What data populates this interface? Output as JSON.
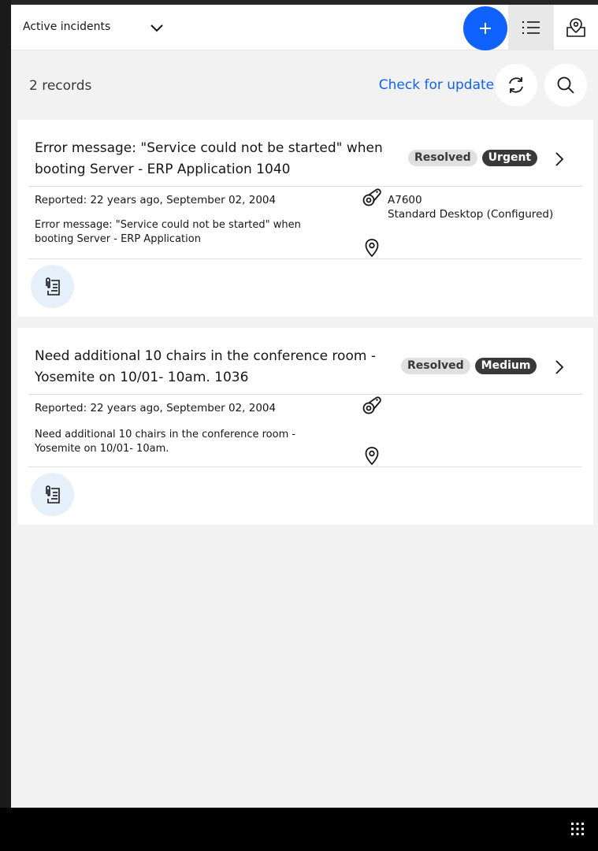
{
  "header": {
    "filter_label": "Active incidents",
    "icons": {
      "chevron": "chevron-down-icon",
      "add": "add-icon",
      "list": "list-view-icon",
      "map": "map-view-icon"
    }
  },
  "toolbar": {
    "records_count": "2 records",
    "check_updates_label": "Check for updates"
  },
  "colors": {
    "accent": "#0f62fe",
    "status_badge": "#e0e0e0",
    "priority_badge": "#393939",
    "attachment_bg": "#e5f0fb"
  },
  "records": [
    {
      "title": "Error message: \"Service could not be started\" when booting Server - ERP Application 1040",
      "status": "Resolved",
      "priority": "Urgent",
      "reported": "Reported: 22 years ago, September 02, 2004",
      "description": "Error message: \"Service could not be started\" when booting Server - ERP Application",
      "asset_id": "A7600",
      "asset_name": "Standard Desktop (Configured)"
    },
    {
      "title": "Need additional 10 chairs in the conference room - Yosemite on 10/01- 10am. 1036",
      "status": "Resolved",
      "priority": "Medium",
      "reported": "Reported: 22 years ago, September 02, 2004",
      "description": "Need additional 10 chairs in the conference room - Yosemite on 10/01- 10am.",
      "asset_id": "",
      "asset_name": ""
    }
  ]
}
